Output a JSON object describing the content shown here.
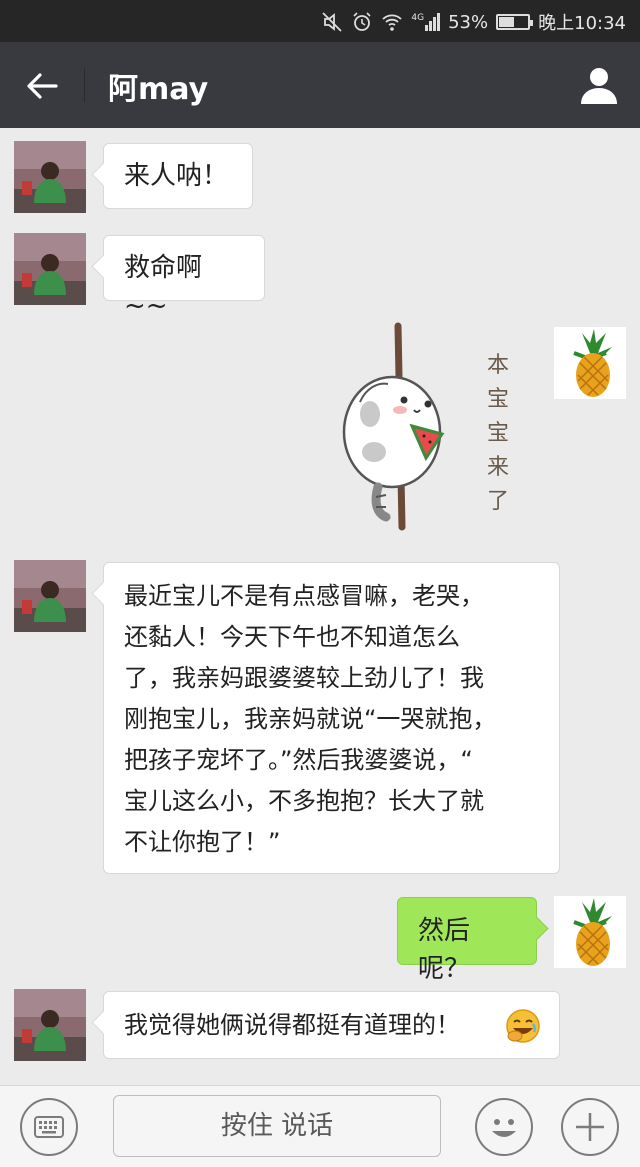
{
  "status_bar": {
    "icons": [
      "mute-icon",
      "alarm-icon",
      "wifi-icon",
      "signal-4g-icon",
      "battery-icon"
    ],
    "network": "4G",
    "battery": "53%",
    "battery_level": 0.53,
    "time": "晚上10:34"
  },
  "header": {
    "title": "阿may",
    "back_icon": "back-arrow-icon",
    "profile_icon": "person-icon"
  },
  "messages": [
    {
      "side": "left",
      "text": "来人呐！"
    },
    {
      "side": "left",
      "text": "救命啊~~"
    },
    {
      "side": "right",
      "type": "sticker",
      "sticker_text": "本宝宝来了"
    },
    {
      "side": "left",
      "lines": [
        "最近宝儿不是有点感冒嘛，老哭，",
        "还黏人！今天下午也不知道怎么",
        "了，我亲妈跟婆婆较上劲儿了！我",
        "刚抱宝儿，我亲妈就说“一哭就抱，",
        "把孩子宠坏了。”然后我婆婆说，“",
        "宝儿这么小，不多抱抱？长大了就",
        "不让你抱了！”"
      ]
    },
    {
      "side": "right",
      "text": "然后呢？"
    },
    {
      "side": "left",
      "text": "我觉得她俩说得都挺有道理的！",
      "emoji": "facepalm-laughing-emoji"
    }
  ],
  "input_bar": {
    "voice_label": "按住 说话",
    "keyboard_icon": "keyboard-icon",
    "emoji_icon": "smiley-icon",
    "plus_icon": "plus-icon"
  },
  "colors": {
    "status_bar": "#262626",
    "title_bar": "#393a3f",
    "chat_bg": "#ebebeb",
    "sent_bubble": "#9fe658",
    "received_bubble": "#ffffff"
  }
}
